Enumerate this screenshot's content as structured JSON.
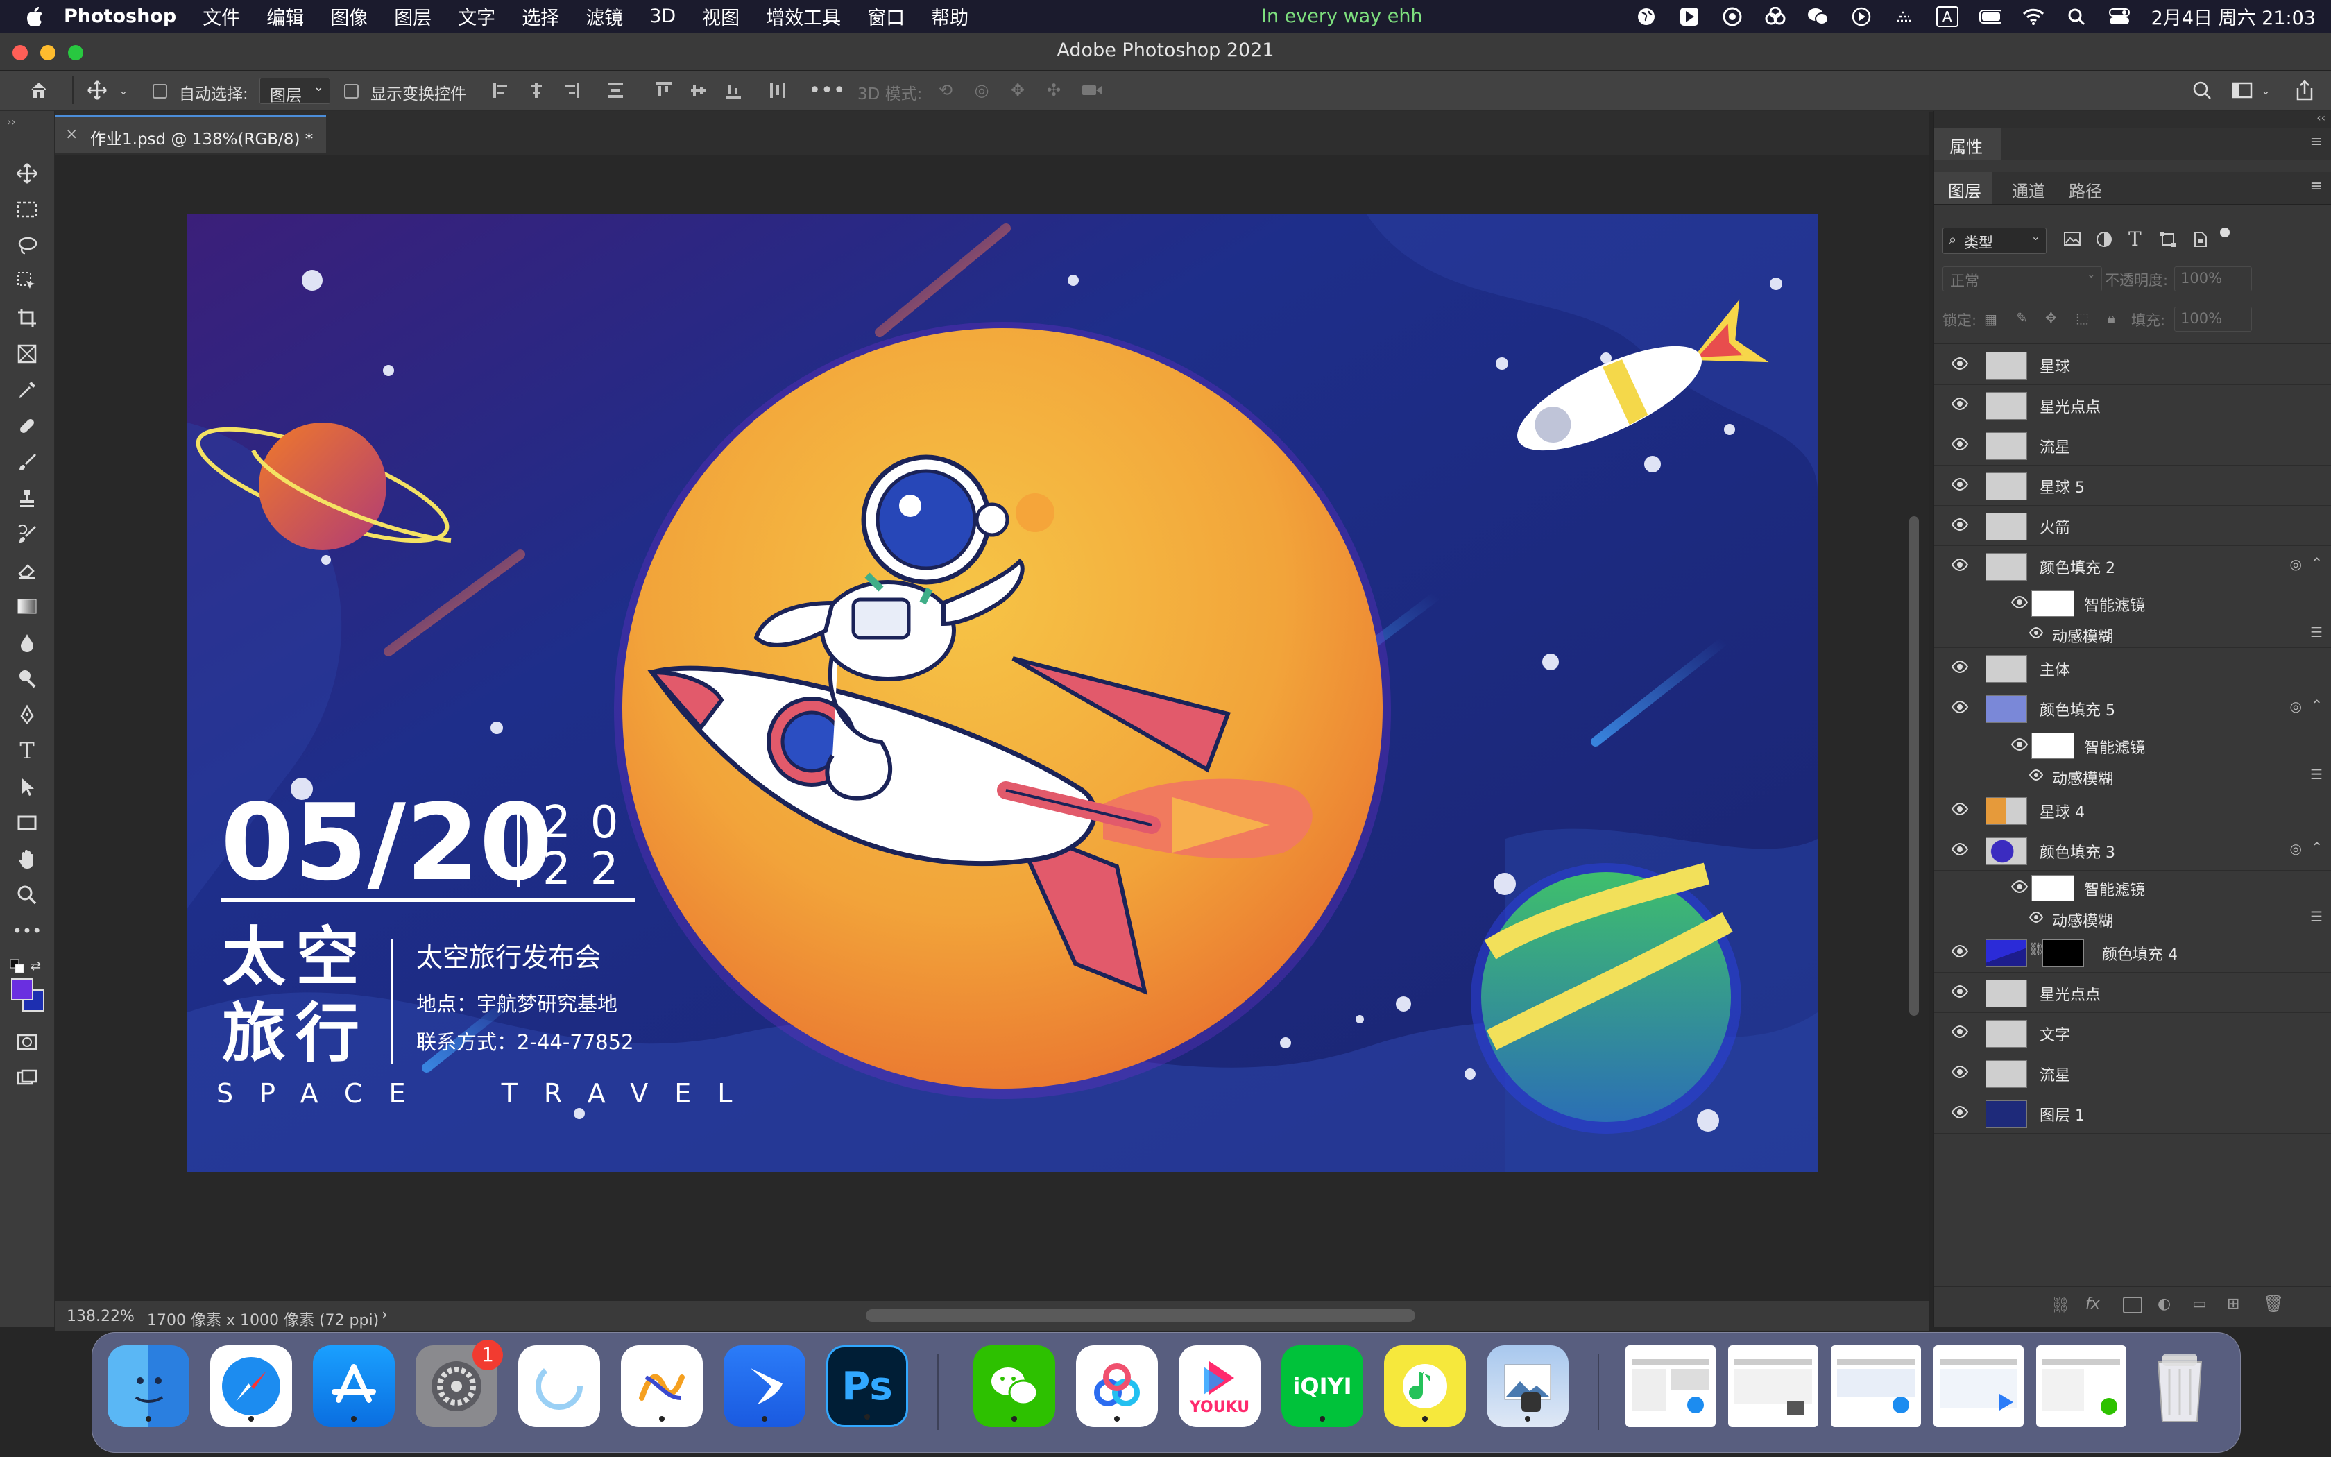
{
  "menubar": {
    "app_name": "Photoshop",
    "menus": [
      "文件",
      "编辑",
      "图像",
      "图层",
      "文字",
      "选择",
      "滤镜",
      "3D",
      "视图",
      "增效工具",
      "窗口",
      "帮助"
    ],
    "now_playing": "In every way ehh",
    "input_method": "A",
    "datetime": "2月4日 周六  21:03"
  },
  "window": {
    "title": "Adobe Photoshop 2021"
  },
  "options": {
    "auto_select_label": "自动选择:",
    "auto_select_value": "图层",
    "show_transform_label": "显示变换控件",
    "mode_3d_label": "3D 模式:"
  },
  "document": {
    "tab_title": "作业1.psd @ 138%(RGB/8) *"
  },
  "poster": {
    "date": "05/20",
    "year_top": "20",
    "year_bottom": "22",
    "title_line1": "太空",
    "title_line2": "旅行",
    "event": "太空旅行发布会",
    "location": "地点：宇航梦研究基地",
    "contact": "联系方式：2-44-77852",
    "english": "SPACE  TRAVEL"
  },
  "status": {
    "zoom": "138.22%",
    "size": "1700 像素 x 1000 像素 (72 ppi)"
  },
  "properties_panel": {
    "title": "属性"
  },
  "layers_panel": {
    "tabs": [
      "图层",
      "通道",
      "路径"
    ],
    "filter_label": "类型",
    "blend_mode": "正常",
    "opacity_label": "不透明度:",
    "opacity_value": "100%",
    "lock_label": "锁定:",
    "fill_label": "填充:",
    "fill_value": "100%",
    "layers": [
      {
        "name": "星球",
        "kind": "layer"
      },
      {
        "name": "星光点点",
        "kind": "layer"
      },
      {
        "name": "流星",
        "kind": "layer"
      },
      {
        "name": "星球 5",
        "kind": "layer"
      },
      {
        "name": "火箭",
        "kind": "layer"
      },
      {
        "name": "颜色填充 2",
        "kind": "smart"
      },
      {
        "name": "智能滤镜",
        "kind": "filter"
      },
      {
        "name": "动感模糊",
        "kind": "filter-item"
      },
      {
        "name": "主体",
        "kind": "layer"
      },
      {
        "name": "颜色填充 5",
        "kind": "smart"
      },
      {
        "name": "智能滤镜",
        "kind": "filter"
      },
      {
        "name": "动感模糊",
        "kind": "filter-item"
      },
      {
        "name": "星球 4",
        "kind": "layer"
      },
      {
        "name": "颜色填充 3",
        "kind": "smart"
      },
      {
        "name": "智能滤镜",
        "kind": "filter"
      },
      {
        "name": "动感模糊",
        "kind": "filter-item"
      },
      {
        "name": "颜色填充 4",
        "kind": "fill"
      },
      {
        "name": "星光点点",
        "kind": "layer"
      },
      {
        "name": "文字",
        "kind": "layer"
      },
      {
        "name": "流星",
        "kind": "layer"
      },
      {
        "name": "图层 1",
        "kind": "layer"
      }
    ]
  },
  "dock": {
    "badge_settings": "1",
    "apps": [
      "finder-icon",
      "safari-icon",
      "app-store-icon",
      "system-preferences-icon",
      "loader-icon",
      "freeform-icon",
      "feishu-icon",
      "photoshop-icon",
      "wechat-icon",
      "baidu-netdisk-icon",
      "youku-icon",
      "iqiyi-icon",
      "qq-music-icon",
      "preview-icon"
    ],
    "photoshop_label": "Ps",
    "youku_label": "YOUKU",
    "iqiyi_label": "iQIYI"
  },
  "colors": {
    "accent": "#4c8eda",
    "poster_bg": "#1e2a7a",
    "sun": "#f1a23b",
    "ps_blue": "#31a8ff"
  }
}
